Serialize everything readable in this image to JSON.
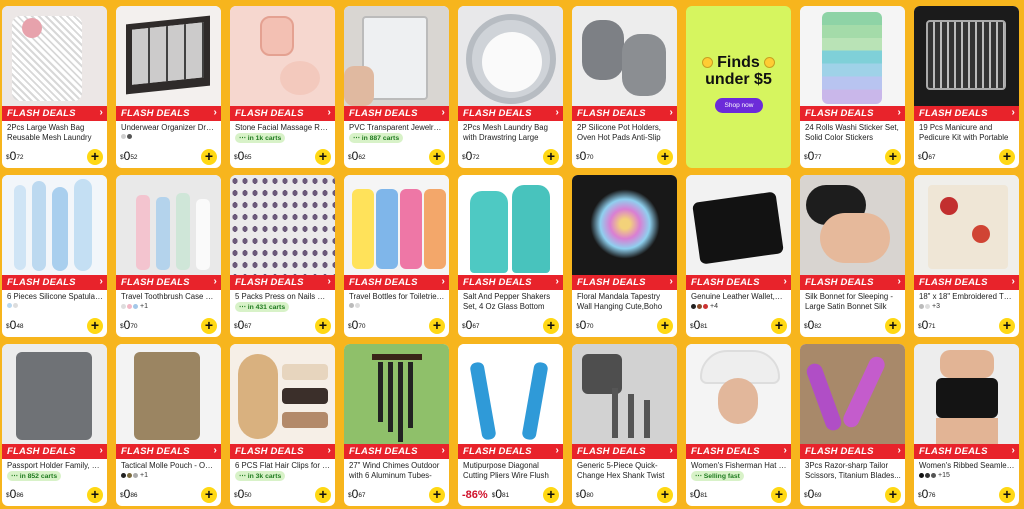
{
  "flash_label": "FLASH DEALS",
  "add_symbol": "+",
  "promo": {
    "line1": "Finds",
    "line2": "under $5",
    "button": "Shop now"
  },
  "rows": [
    [
      {
        "title": "2Pcs Large Wash Bag Reusable Mesh Laundry Bag with...",
        "price_main": "0",
        "price_frac": "72",
        "sub_type": "none"
      },
      {
        "title": "Underwear Organizer Drawer...",
        "price_main": "0",
        "price_frac": "52",
        "sub_type": "dots",
        "dots": [
          "#cfcfcf",
          "#555"
        ]
      },
      {
        "title": "Stone Facial Massage Roller a...",
        "price_main": "0",
        "price_frac": "65",
        "sub_type": "badge",
        "badge": "in 1k carts"
      },
      {
        "title": "PVC Transparent Jewelry Sto...",
        "price_main": "0",
        "price_frac": "62",
        "sub_type": "badge",
        "badge": "in 887 carts"
      },
      {
        "title": "2Pcs Mesh Laundry Bag with Drawstring Large Wash Bag f...",
        "price_main": "0",
        "price_frac": "72",
        "sub_type": "none"
      },
      {
        "title": "2P Silicone Pot Holders, Oven Hot Pads Anti-Slip Silicone...",
        "price_main": "0",
        "price_frac": "70",
        "sub_type": "none"
      },
      {
        "promo": true
      },
      {
        "title": "24 Rolls Washi Sticker Set, Solid Color Stickers Decorativ...",
        "price_main": "0",
        "price_frac": "77",
        "sub_type": "none"
      },
      {
        "title": "19 Pcs Manicure and Pedicure Kit with Portable Case Nail...",
        "price_main": "0",
        "price_frac": "67",
        "sub_type": "none"
      }
    ],
    [
      {
        "title": "6 Pieces Silicone Spatula Set,...",
        "price_main": "0",
        "price_frac": "48",
        "sub_type": "dots",
        "dots": [
          "#b9d7ef",
          "#ddd"
        ]
      },
      {
        "title": "Travel Toothbrush Case with ...",
        "price_main": "0",
        "price_frac": "70",
        "sub_type": "dots",
        "dots": [
          "#ddd",
          "#f2b8c6",
          "#a4c7e8"
        ],
        "more": "+1"
      },
      {
        "title": "5 Packs Press on Nails Metalli...",
        "price_main": "0",
        "price_frac": "67",
        "sub_type": "badge",
        "badge": "in 431 carts"
      },
      {
        "title": "Travel Bottles for Toiletries,T...",
        "price_main": "0",
        "price_frac": "70",
        "sub_type": "dots",
        "dots": [
          "#bbb",
          "#ddd"
        ]
      },
      {
        "title": "Salt And Pepper Shakers Set, 4 Oz Glass Bottom Salt And...",
        "price_main": "0",
        "price_frac": "67",
        "sub_type": "none"
      },
      {
        "title": "Floral Mandala Tapestry Wall Hanging Cute,Boho Wall...",
        "price_main": "0",
        "price_frac": "70",
        "sub_type": "none"
      },
      {
        "title": "Genuine Leather Wallet,RFID ...",
        "price_main": "0",
        "price_frac": "81",
        "sub_type": "dots",
        "dots": [
          "#222",
          "#8a4b2a",
          "#c33"
        ],
        "more": "+4"
      },
      {
        "title": "Silk Bonnet for Sleeping - Large Satin Bonnet Silk Hair...",
        "price_main": "0",
        "price_frac": "82",
        "sub_type": "none"
      },
      {
        "title": "18\" x 18\" Embroidered Throw...",
        "price_main": "0",
        "price_frac": "71",
        "sub_type": "dots",
        "dots": [
          "#bbb",
          "#ddd"
        ],
        "more": "+3"
      }
    ],
    [
      {
        "title": "Passport Holder Family, Wom...",
        "price_main": "0",
        "price_frac": "86",
        "sub_type": "badge",
        "badge": "in 852 carts"
      },
      {
        "title": "Tactical Molle Pouch - Outdo...",
        "price_main": "0",
        "price_frac": "86",
        "sub_type": "dots",
        "dots": [
          "#222",
          "#7a6a3e",
          "#aaa"
        ],
        "more": "+1"
      },
      {
        "title": "6 PCS Flat Hair Clips for Wo...",
        "price_main": "0",
        "price_frac": "50",
        "sub_type": "badge",
        "badge": "in 3k carts"
      },
      {
        "title": "27\" Wind Chimes Outdoor with 6 Aluminum Tubes-Memorial...",
        "price_main": "0",
        "price_frac": "67",
        "sub_type": "none"
      },
      {
        "title": "Mutipurpose Diagonal Cutting Pliers Wire Flush Cutters Car...",
        "price_main": "0",
        "price_frac": "81",
        "discount": "-86%",
        "sub_type": "none"
      },
      {
        "title": "Generic 5-Piece Quick-Change Hex Shank Twist Drill Bit Set...",
        "price_main": "0",
        "price_frac": "80",
        "sub_type": "none"
      },
      {
        "title": "Women's Fisherman Hat - Ou...",
        "price_main": "0",
        "price_frac": "81",
        "sub_type": "badge",
        "badge": "Selling fast"
      },
      {
        "title": "3Pcs Razor-sharp Tailor Scissors, Titanium Blades...",
        "price_main": "0",
        "price_frac": "69",
        "sub_type": "none"
      },
      {
        "title": "Women's Ribbed Seamless Hi...",
        "price_main": "0",
        "price_frac": "76",
        "sub_type": "dots",
        "dots": [
          "#111",
          "#333",
          "#555"
        ],
        "more": "+15"
      }
    ]
  ]
}
